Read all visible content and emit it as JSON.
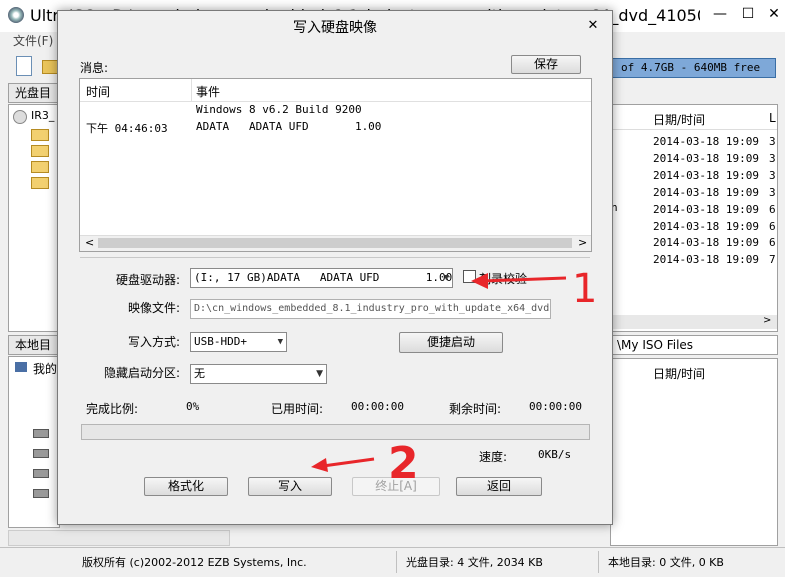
{
  "main_window": {
    "title": "UltraISO - D:\\cn_windows_embedded_8.1_industry_pro_with_update_x64_dvd_41050105...",
    "close_glyph": "✕",
    "min_glyph": "—",
    "max_glyph": "☐",
    "menu_file": "文件(F)",
    "capacity_text": "of 4.7GB - 640MB free",
    "panel_disc_label": "光盘目",
    "panel_local_label": "本地目",
    "disc_tree_root": "IR3_",
    "local_tree_root": "我的",
    "local_path_label": "\\My ISO Files",
    "date_header": "日期/时间",
    "col_l": "L",
    "partial_letter": "n",
    "dates": [
      "2014-03-18 19:09",
      "2014-03-18 19:09",
      "2014-03-18 19:09",
      "2014-03-18 19:09",
      "2014-03-18 19:09",
      "2014-03-18 19:09",
      "2014-03-18 19:09",
      "2014-03-18 19:09"
    ],
    "sizes": [
      "3",
      "3",
      "3",
      "3",
      "6",
      "6",
      "6",
      "7"
    ]
  },
  "statusbar": {
    "copyright": "版权所有 (c)2002-2012 EZB Systems, Inc.",
    "disc_dir": "光盘目录: 4 文件, 2034 KB",
    "local_dir": "本地目录: 0 文件, 0 KB"
  },
  "dialog": {
    "title": "写入硬盘映像",
    "close_glyph": "✕",
    "messages_label": "消息:",
    "save_button": "保存",
    "log_headers": {
      "time": "时间",
      "event": "事件"
    },
    "log_rows": [
      {
        "time": "",
        "event": "Windows 8 v6.2 Build 9200"
      },
      {
        "time": "下午 04:46:03",
        "event": "ADATA   ADATA UFD       1.00"
      }
    ],
    "drive_label": "硬盘驱动器:",
    "drive_value": "(I:, 17 GB)ADATA   ADATA UFD       1.00",
    "verify_label": "刻录校验",
    "image_label": "映像文件:",
    "image_value": "D:\\cn_windows_embedded_8.1_industry_pro_with_update_x64_dvd",
    "write_mode_label": "写入方式:",
    "write_mode_value": "USB-HDD+",
    "quick_boot_button": "便捷启动",
    "hidden_part_label": "隐藏启动分区:",
    "hidden_part_value": "无",
    "progress_label": "完成比例:",
    "progress_value": "0%",
    "elapsed_label": "已用时间:",
    "elapsed_value": "00:00:00",
    "remaining_label": "剩余时间:",
    "remaining_value": "00:00:00",
    "speed_label": "速度:",
    "speed_value": "0KB/s",
    "progress_fraction": 0,
    "format_button": "格式化",
    "write_button": "写入",
    "stop_button": "终止[A]",
    "back_button": "返回"
  },
  "annotations": {
    "color": "#e8262a",
    "mark_1": "1",
    "mark_2": "2"
  }
}
